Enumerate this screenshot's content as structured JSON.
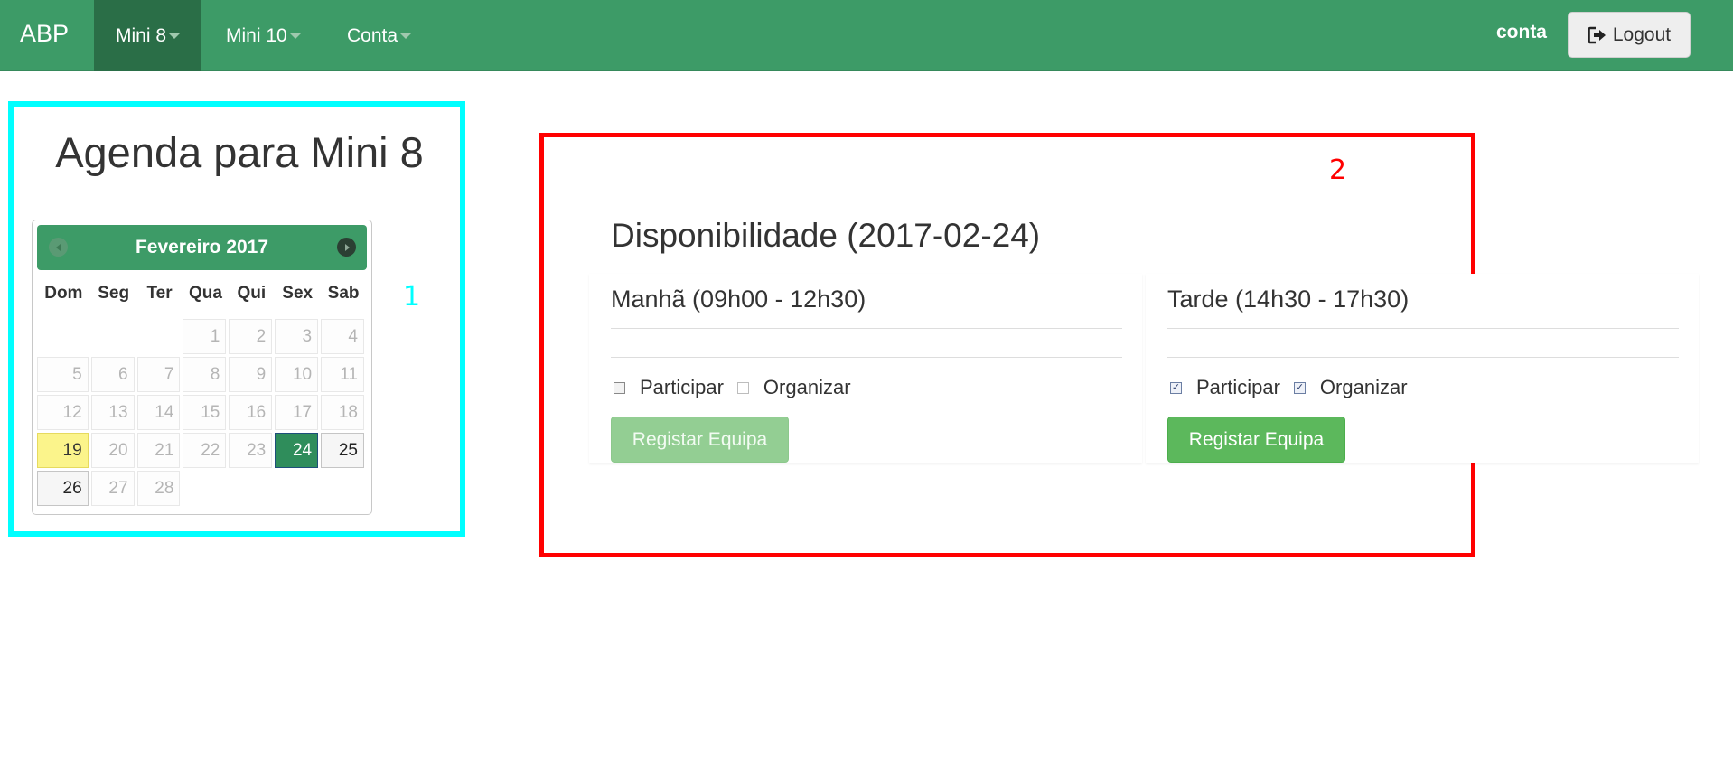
{
  "navbar": {
    "brand": "ABP",
    "items": [
      {
        "label": "Mini 8",
        "active": true
      },
      {
        "label": "Mini 10",
        "active": false
      },
      {
        "label": "Conta",
        "active": false
      }
    ],
    "user": "conta",
    "logout_label": "Logout",
    "colors": {
      "bar": "#3d9b67",
      "active": "#2a6e47"
    }
  },
  "annotations": {
    "label_1": "1",
    "label_2": "2",
    "color_1": "#00ffff",
    "color_2": "#ff0000"
  },
  "agenda": {
    "title": "Agenda para Mini 8",
    "calendar": {
      "month_label": "Fevereiro 2017",
      "prev_icon": "prev-circle-icon",
      "next_icon": "next-circle-icon",
      "weekdays": [
        "Dom",
        "Seg",
        "Ter",
        "Qua",
        "Qui",
        "Sex",
        "Sab"
      ],
      "weeks": [
        [
          "",
          "",
          "",
          "1",
          "2",
          "3",
          "4"
        ],
        [
          "5",
          "6",
          "7",
          "8",
          "9",
          "10",
          "11"
        ],
        [
          "12",
          "13",
          "14",
          "15",
          "16",
          "17",
          "18"
        ],
        [
          "19",
          "20",
          "21",
          "22",
          "23",
          "24",
          "25"
        ],
        [
          "26",
          "27",
          "28",
          "",
          "",
          "",
          ""
        ]
      ],
      "today": "19",
      "selected": "24",
      "available": [
        "25",
        "26"
      ]
    }
  },
  "availability": {
    "title": "Disponibilidade (2017-02-24)",
    "periods": [
      {
        "title": "Manhã (09h00 - 12h30)",
        "participar_label": "Participar",
        "organizar_label": "Organizar",
        "participar_checked": false,
        "organizar_checked": false,
        "button_label": "Registar Equipa",
        "button_enabled": false
      },
      {
        "title": "Tarde (14h30 - 17h30)",
        "participar_label": "Participar",
        "organizar_label": "Organizar",
        "participar_checked": true,
        "organizar_checked": true,
        "button_label": "Registar Equipa",
        "button_enabled": true
      }
    ]
  }
}
